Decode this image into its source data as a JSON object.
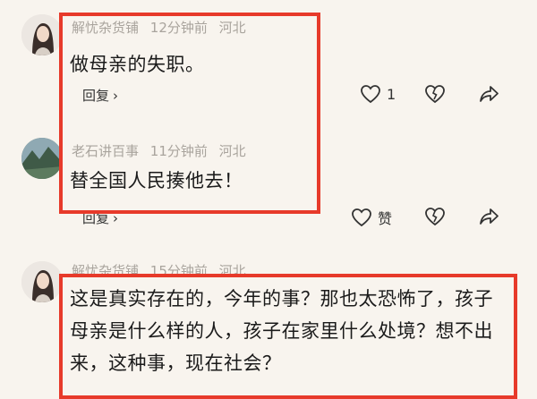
{
  "comments": [
    {
      "username": "解忧杂货铺",
      "time": "12分钟前",
      "location": "河北",
      "text": "做母亲的失职。",
      "reply_label": "回复",
      "like_count": "1"
    },
    {
      "username": "老石讲百事",
      "time": "11分钟前",
      "location": "河北",
      "text": "替全国人民揍他去！",
      "reply_label": "回复",
      "like_label": "赞"
    },
    {
      "username": "解忧杂货铺",
      "time": "15分钟前",
      "location": "河北",
      "text": "这是真实存在的，今年的事？那也太恐怖了，孩子母亲是什么样的人，孩子在家里什么处境？想不出来，这种事，现在社会？"
    }
  ],
  "colors": {
    "highlight_box": "#e73a2a",
    "background": "#f8f4ee",
    "meta_text": "#a9a49d"
  },
  "icons": {
    "like": "heart-outline-icon",
    "dislike": "broken-heart-icon",
    "share": "share-arrow-icon",
    "reply_chevron": "chevron-right-icon"
  }
}
